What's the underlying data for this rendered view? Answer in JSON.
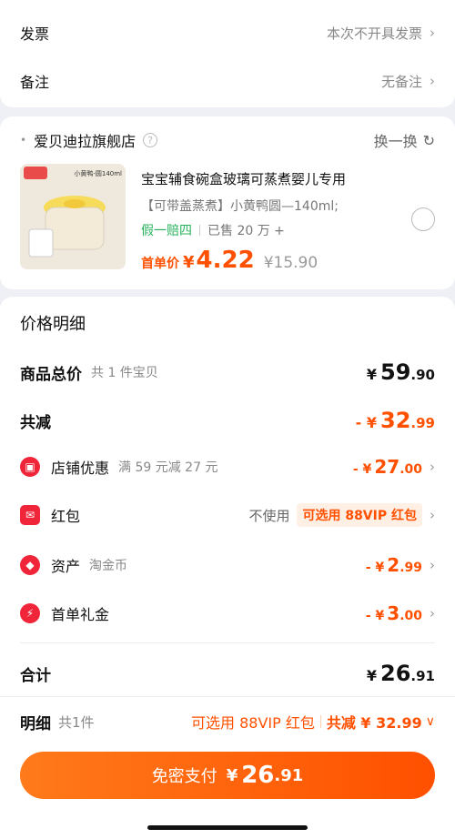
{
  "invoice": {
    "label": "发票",
    "value": "本次不开具发票"
  },
  "remark": {
    "label": "备注",
    "value": "无备注"
  },
  "store": {
    "name": "爱贝迪拉旗舰店",
    "swap": "换一换"
  },
  "product": {
    "title": "宝宝辅食碗盒玻璃可蒸煮婴儿专用",
    "variant": "【可带盖蒸煮】小黄鸭圆—140ml;",
    "guarantee": "假一赔四",
    "sold": "已售 20 万 +",
    "price_label": "首单价",
    "currency": "¥",
    "price": "4.22",
    "orig_price": "¥15.90",
    "thumb_tag": "小黄鸭-圆140ml"
  },
  "price_detail": {
    "title": "价格明细",
    "goods_total": {
      "label": "商品总价",
      "sub": "共 1 件宝贝",
      "int": "59",
      "dec": ".90",
      "currency": "¥"
    },
    "reduce": {
      "label": "共减",
      "prefix": "- ¥",
      "int": "32",
      "dec": ".99"
    },
    "shop_discount": {
      "label": "店铺优惠",
      "sub": "满 59 元减 27 元",
      "prefix": "- ¥",
      "int": "27",
      "dec": ".00"
    },
    "redpacket": {
      "label": "红包",
      "state": "不使用",
      "pill": "可选用 88VIP 红包"
    },
    "asset": {
      "label": "资产",
      "sub": "淘金币",
      "prefix": "- ¥",
      "int": "2",
      "dec": ".99"
    },
    "first_gift": {
      "label": "首单礼金",
      "prefix": "- ¥",
      "int": "3",
      "dec": ".00"
    },
    "total": {
      "label": "合计",
      "currency": "¥",
      "int": "26",
      "dec": ".91"
    }
  },
  "bottom_bar": {
    "detail_label": "明细",
    "count": "共1件",
    "vip_text": "可选用 88VIP 红包",
    "reduce_text": "共减 ¥ 32.99",
    "pay_label": "免密支付",
    "pay_currency": "¥",
    "pay_int": "26",
    "pay_dec": ".91"
  }
}
